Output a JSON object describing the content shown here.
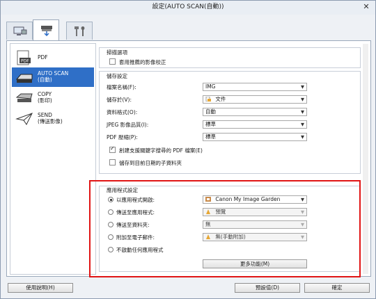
{
  "window": {
    "title": "設定(AUTO SCAN(自動))",
    "close_glyph": "✕"
  },
  "tabs": [
    {
      "name": "scan-from-computer",
      "icon": "computer-scan-icon"
    },
    {
      "name": "scan-from-operation-panel",
      "icon": "scanner-icon"
    },
    {
      "name": "general-settings",
      "icon": "tools-icon"
    }
  ],
  "sidebar": {
    "items": [
      {
        "label": "PDF",
        "icon": "pdf-icon"
      },
      {
        "label": "AUTO SCAN\n(自動)",
        "icon": "scanner-auto-icon"
      },
      {
        "label": "COPY\n(影印)",
        "icon": "copy-icon"
      },
      {
        "label": "SEND\n(傳送影像)",
        "icon": "send-icon"
      }
    ]
  },
  "scan_options": {
    "title": "掃描選項",
    "apply_correction_label": "套用推薦的影像校正",
    "apply_correction_checked": false
  },
  "save_settings": {
    "title": "儲存設定",
    "file_name_label": "檔案名稱(F):",
    "file_name_value": "IMG",
    "save_in_label": "儲存於(V):",
    "save_in_value": "文件",
    "data_format_label": "資料格式(O):",
    "data_format_value": "自動",
    "jpeg_quality_label": "JPEG 影像品質(I):",
    "jpeg_quality_value": "標準",
    "pdf_compression_label": "PDF 壓縮(P):",
    "pdf_compression_value": "標準",
    "create_searchable_pdf_label": "創建支援關鍵字搜尋的 PDF 檔案(E)",
    "create_searchable_pdf_checked": true,
    "save_to_date_subfolder_label": "儲存到目前日期的子資料夾",
    "save_to_date_subfolder_checked": false
  },
  "application_settings": {
    "title": "應用程式設定",
    "open_with_label": "以應用程式開啟:",
    "open_with_value": "Canon My Image Garden",
    "open_with_selected": true,
    "send_to_app_label": "傳送至應用程式:",
    "send_to_app_value": "預覽",
    "send_to_folder_label": "傳送至資料夾:",
    "send_to_folder_value": "無",
    "attach_email_label": "附加至電子郵件:",
    "attach_email_value": "無(手動附加)",
    "no_app_label": "不啟動任何應用程式",
    "more_functions_label": "更多功能(M)"
  },
  "footer": {
    "help_label": "使用說明(H)",
    "defaults_label": "預設值(D)",
    "ok_label": "確定"
  },
  "colors": {
    "accent": "#2f6fc7",
    "highlight_border": "#e01414"
  }
}
